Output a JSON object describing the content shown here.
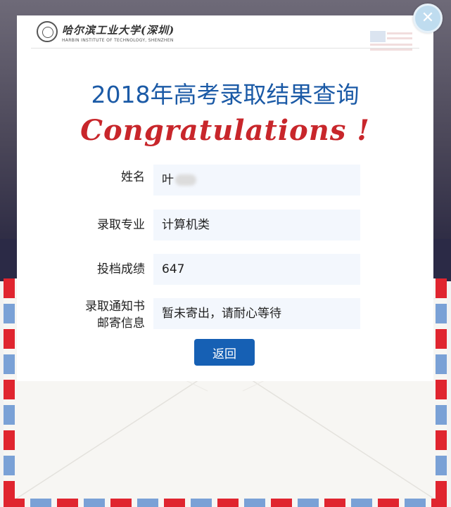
{
  "logo": {
    "name_cn": "哈尔滨工业大学(深圳)",
    "name_en": "HARBIN INSTITUTE OF TECHNOLOGY, SHENZHEN"
  },
  "title": "2018年高考录取结果查询",
  "congrats": "Congratulations !",
  "fields": [
    {
      "label": "姓名",
      "value": "叶"
    },
    {
      "label": "录取专业",
      "value": "计算机类"
    },
    {
      "label": "投档成绩",
      "value": "647"
    },
    {
      "label": "录取通知书\n邮寄信息",
      "value": "暂未寄出，请耐心等待"
    }
  ],
  "back_button": "返回",
  "close_glyph": "✕",
  "colors": {
    "title": "#1b5aa6",
    "congrats": "#c8262b",
    "button": "#1660b4",
    "field_bg": "#f3f7fd",
    "envelope_red": "#e0252f",
    "envelope_blue": "#7aa1d6"
  }
}
